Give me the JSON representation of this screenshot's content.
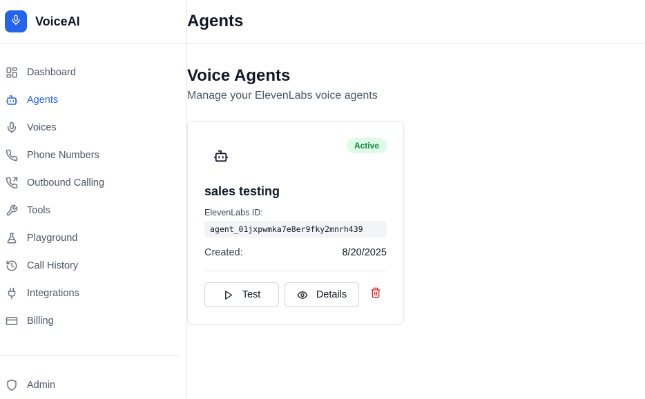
{
  "brand": {
    "name": "VoiceAI",
    "icon": "mic-icon",
    "color": "#2563eb"
  },
  "sidebar": {
    "items": [
      {
        "label": "Dashboard",
        "icon": "dashboard-icon"
      },
      {
        "label": "Agents",
        "icon": "bot-icon",
        "active": true
      },
      {
        "label": "Voices",
        "icon": "mic-icon"
      },
      {
        "label": "Phone Numbers",
        "icon": "phone-icon"
      },
      {
        "label": "Outbound Calling",
        "icon": "phone-outgoing-icon"
      },
      {
        "label": "Tools",
        "icon": "wrench-icon"
      },
      {
        "label": "Playground",
        "icon": "flask-icon"
      },
      {
        "label": "Call History",
        "icon": "history-icon"
      },
      {
        "label": "Integrations",
        "icon": "plug-icon"
      },
      {
        "label": "Billing",
        "icon": "credit-card-icon"
      }
    ],
    "admin": {
      "label": "Admin",
      "icon": "shield-icon"
    }
  },
  "header": {
    "title": "Agents"
  },
  "main": {
    "title": "Voice Agents",
    "subtitle": "Manage your ElevenLabs voice agents",
    "agents": [
      {
        "icon": "bot-icon",
        "status": "Active",
        "name": "sales testing",
        "id_label": "ElevenLabs ID:",
        "id": "agent_01jxpwmka7e8er9fky2mnrh439",
        "created_label": "Created:",
        "created": "8/20/2025",
        "test_label": "Test",
        "details_label": "Details",
        "delete_icon": "trash-icon"
      }
    ]
  },
  "colors": {
    "accent": "#2563eb",
    "active_badge_bg": "#dcfce7",
    "active_badge_text": "#15803d",
    "danger": "#dc2626"
  }
}
